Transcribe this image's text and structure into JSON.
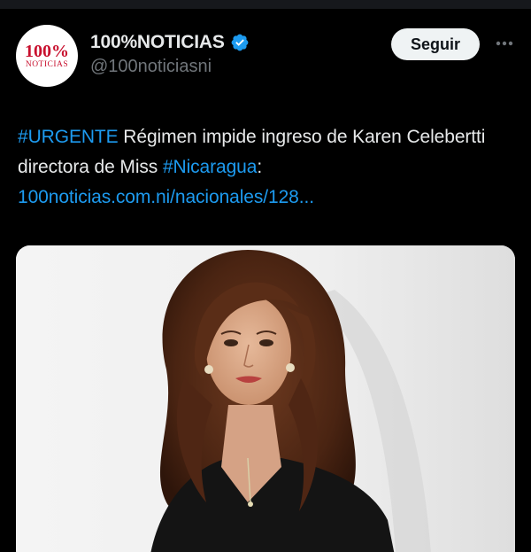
{
  "account": {
    "avatar_text_top": "100%",
    "avatar_text_bottom": "NOTICIAS",
    "display_name": "100%NOTICIAS",
    "handle": "@100noticiasni",
    "verified": true
  },
  "actions": {
    "follow_label": "Seguir",
    "more_icon": "more-horizontal-icon"
  },
  "tweet": {
    "hashtag_1": "#URGENTE",
    "text_1": " Régimen impide ingreso de Karen Celebertti directora de Miss ",
    "hashtag_2": "#Nicaragua",
    "text_2": ":",
    "link": "100noticias.com.ni/nacionales/128..."
  },
  "colors": {
    "background": "#000000",
    "link": "#1d9bf0",
    "verified": "#1d9bf0",
    "handle": "#71767b",
    "brand_red": "#c8102e"
  }
}
